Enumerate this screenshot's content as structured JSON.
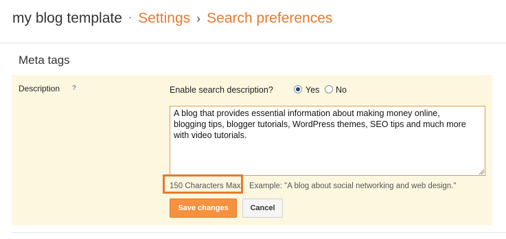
{
  "header": {
    "app_name": "my blog template",
    "dot": "·",
    "crumb_settings": "Settings",
    "separator": "›",
    "crumb_search": "Search preferences"
  },
  "section": {
    "title": "Meta tags"
  },
  "description": {
    "label": "Description",
    "help": "?",
    "enable_label": "Enable search description?",
    "option_yes": "Yes",
    "option_no": "No",
    "selected": "Yes",
    "text_value": "A blog that provides essential information about making money online,\nblogging tips, blogger tutorials, WordPress themes, SEO tips and much more\nwith video tutorials.",
    "char_limit": "150 Characters Max.",
    "example": "Example: \"A blog about social networking and web design.\""
  },
  "buttons": {
    "save": "Save changes",
    "cancel": "Cancel"
  },
  "colors": {
    "accent": "#e8792d",
    "panel_bg": "#fdf7e0",
    "save_bg": "#f5913f"
  }
}
